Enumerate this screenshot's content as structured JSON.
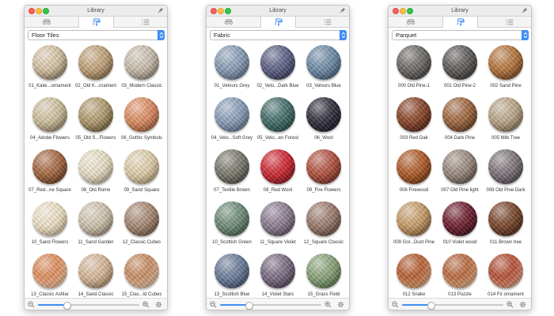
{
  "windows": [
    {
      "title": "Library",
      "category": "Floor Tiles",
      "zoom_fraction": 0.28,
      "materials": [
        {
          "name": "01_Kalei...ornament",
          "colors": [
            "#d8c6a7",
            "#6e5a43"
          ]
        },
        {
          "name": "02_Old K...rnament",
          "colors": [
            "#c3a47b",
            "#6e5132"
          ]
        },
        {
          "name": "03_Modern Classic",
          "colors": [
            "#ccc1b0",
            "#7b6d5c"
          ]
        },
        {
          "name": "04_Adobe Flowers",
          "colors": [
            "#d2c4a1",
            "#786a46"
          ]
        },
        {
          "name": "05_Old S...Flowers",
          "colors": [
            "#b39d6f",
            "#564426"
          ]
        },
        {
          "name": "06_Gothic Symbols",
          "colors": [
            "#e08e62",
            "#8a4a2c"
          ]
        },
        {
          "name": "07_Red...ne Square",
          "colors": [
            "#a7683f",
            "#4e2815"
          ]
        },
        {
          "name": "08_Old Rome",
          "colors": [
            "#ece2ca",
            "#a99a79"
          ]
        },
        {
          "name": "09_Sand Square",
          "colors": [
            "#e2d1ad",
            "#9f8a60"
          ]
        },
        {
          "name": "10_Sand Flowers",
          "colors": [
            "#f0e4c9",
            "#b3a27c"
          ]
        },
        {
          "name": "11_Sand Garden",
          "colors": [
            "#d2c6b0",
            "#837460"
          ]
        },
        {
          "name": "12_Classic Cubes",
          "colors": [
            "#aa8a74",
            "#5a4232"
          ]
        },
        {
          "name": "13_Classic Ashlar",
          "colors": [
            "#e08b5a",
            "#e7d8c4"
          ]
        },
        {
          "name": "14_Sand Classic",
          "colors": [
            "#d8b99a",
            "#8d6e50"
          ]
        },
        {
          "name": "15_Clas...ld Cubes",
          "colors": [
            "#c88a5e",
            "#ede0cf"
          ]
        }
      ]
    },
    {
      "title": "Library",
      "category": "Fabric",
      "zoom_fraction": 0.28,
      "materials": [
        {
          "name": "01_Velours Grey",
          "colors": [
            "#8a9fb8",
            "#4c5d73"
          ]
        },
        {
          "name": "02_Velo...Dark Blue",
          "colors": [
            "#5c5f86",
            "#2a2c48"
          ]
        },
        {
          "name": "03_Velours Blue",
          "colors": [
            "#6f8ca8",
            "#344a62"
          ]
        },
        {
          "name": "04_Velo...Soft Grey",
          "colors": [
            "#8ba0bb",
            "#4d5f77"
          ]
        },
        {
          "name": "05_Velo...en Forest",
          "colors": [
            "#426e6a",
            "#1c3936"
          ]
        },
        {
          "name": "06_Wool",
          "colors": [
            "#2e2c3a",
            "#0c0b14"
          ]
        },
        {
          "name": "07_Textile Brown",
          "colors": [
            "#7b7a6e",
            "#3b3a30"
          ]
        },
        {
          "name": "08_Red Wool",
          "colors": [
            "#d12530",
            "#6d0812"
          ]
        },
        {
          "name": "09_Fire Flowers",
          "colors": [
            "#b5513f",
            "#5a1d12"
          ]
        },
        {
          "name": "10_Scottish Green",
          "colors": [
            "#6f8d78",
            "#2f4a38"
          ]
        },
        {
          "name": "11_Square Violet",
          "colors": [
            "#8d7d93",
            "#473b4d"
          ]
        },
        {
          "name": "12_Square Classic",
          "colors": [
            "#9d7c6e",
            "#4c3328"
          ]
        },
        {
          "name": "13_Scottish Blue",
          "colors": [
            "#6b7d9b",
            "#2d3c58"
          ]
        },
        {
          "name": "14_Violet Stars",
          "colors": [
            "#7a6b82",
            "#3a2e42"
          ]
        },
        {
          "name": "15_Grass Field",
          "colors": [
            "#8aa57a",
            "#425c36"
          ]
        }
      ]
    },
    {
      "title": "Library",
      "category": "Parquet",
      "zoom_fraction": 0.28,
      "materials": [
        {
          "name": "000 Old Pine-1",
          "colors": [
            "#6d6a67",
            "#2c2926"
          ]
        },
        {
          "name": "001 Old Pine-2",
          "colors": [
            "#5e5b59",
            "#272421"
          ]
        },
        {
          "name": "002 Sand Pine",
          "colors": [
            "#b8753c",
            "#5a3010"
          ]
        },
        {
          "name": "003 Red Oak",
          "colors": [
            "#8a4325",
            "#3a150a"
          ]
        },
        {
          "name": "004 Dark Pine",
          "colors": [
            "#a0673d",
            "#4a2a12"
          ]
        },
        {
          "name": "005 Milk Tree",
          "colors": [
            "#bda88a",
            "#6a5840"
          ]
        },
        {
          "name": "006 Firewood",
          "colors": [
            "#b25a26",
            "#5a2508"
          ]
        },
        {
          "name": "007 Old Pine light",
          "colors": [
            "#9c8a80",
            "#4a3a32"
          ]
        },
        {
          "name": "008 Old Pine Dark",
          "colors": [
            "#80767c",
            "#3a3238"
          ]
        },
        {
          "name": "009 Gol...Dust Pine",
          "colors": [
            "#caa06a",
            "#6e4b20"
          ]
        },
        {
          "name": "010 Violet wood",
          "colors": [
            "#6e1a2c",
            "#2a0510"
          ]
        },
        {
          "name": "011 Brown tree",
          "colors": [
            "#7a4528",
            "#35180a"
          ]
        },
        {
          "name": "012 Snake",
          "colors": [
            "#b55a2c",
            "#e8c9a0"
          ]
        },
        {
          "name": "013 Puzzle",
          "colors": [
            "#b8653a",
            "#f0d5b0"
          ]
        },
        {
          "name": "014 Fir ornament",
          "colors": [
            "#b34a30",
            "#ecc8a8"
          ]
        }
      ]
    }
  ]
}
